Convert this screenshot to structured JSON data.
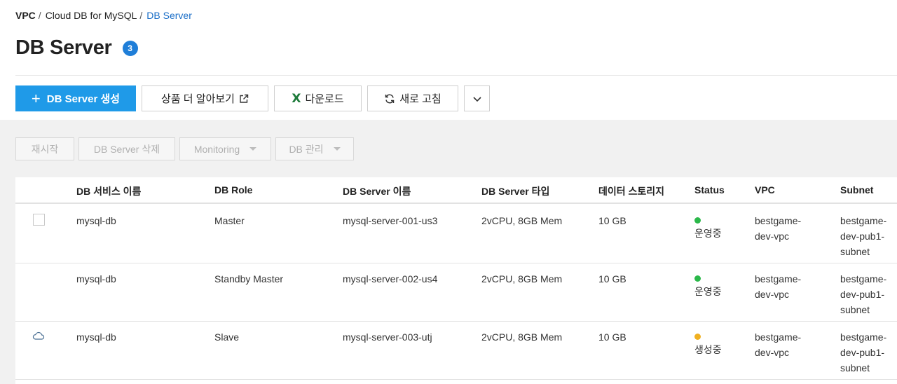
{
  "breadcrumb": {
    "items": [
      "VPC",
      "Cloud DB for MySQL"
    ],
    "separator": "/",
    "current": "DB Server"
  },
  "page": {
    "title": "DB Server",
    "count": "3"
  },
  "toolbar": {
    "create_label": "DB Server 생성",
    "learn_label": "상품 더 알아보기",
    "download_label": "다운로드",
    "refresh_label": "새로 고침"
  },
  "actions": {
    "restart_label": "재시작",
    "delete_label": "DB Server 삭제",
    "monitoring_label": "Monitoring",
    "db_manage_label": "DB 관리"
  },
  "table": {
    "columns": [
      "DB 서비스 이름",
      "DB Role",
      "DB Server 이름",
      "DB Server 타입",
      "데이터 스토리지",
      "Status",
      "VPC",
      "Subnet"
    ],
    "rows": [
      {
        "service_name": "mysql-db",
        "role": "Master",
        "server_name": "mysql-server-001-us3",
        "server_type": "2vCPU, 8GB Mem",
        "storage": "10 GB",
        "status": "운영중",
        "status_color": "#2bb84a",
        "vpc": "bestgame-dev-vpc",
        "subnet": "bestgame-dev-pub1-subnet",
        "selector": "checkbox"
      },
      {
        "service_name": "mysql-db",
        "role": "Standby Master",
        "server_name": "mysql-server-002-us4",
        "server_type": "2vCPU, 8GB Mem",
        "storage": "10 GB",
        "status": "운영중",
        "status_color": "#2bb84a",
        "vpc": "bestgame-dev-vpc",
        "subnet": "bestgame-dev-pub1-subnet",
        "selector": "none"
      },
      {
        "service_name": "mysql-db",
        "role": "Slave",
        "server_name": "mysql-server-003-utj",
        "server_type": "2vCPU, 8GB Mem",
        "storage": "10 GB",
        "status": "생성중",
        "status_color": "#f0b020",
        "vpc": "bestgame-dev-vpc",
        "subnet": "bestgame-dev-pub1-subnet",
        "selector": "cloud-icon"
      }
    ]
  },
  "colors": {
    "primary": "#1f9ae8",
    "link": "#1a6ec7",
    "badge": "#1f7ed8",
    "excel": "#1d7a3a"
  }
}
